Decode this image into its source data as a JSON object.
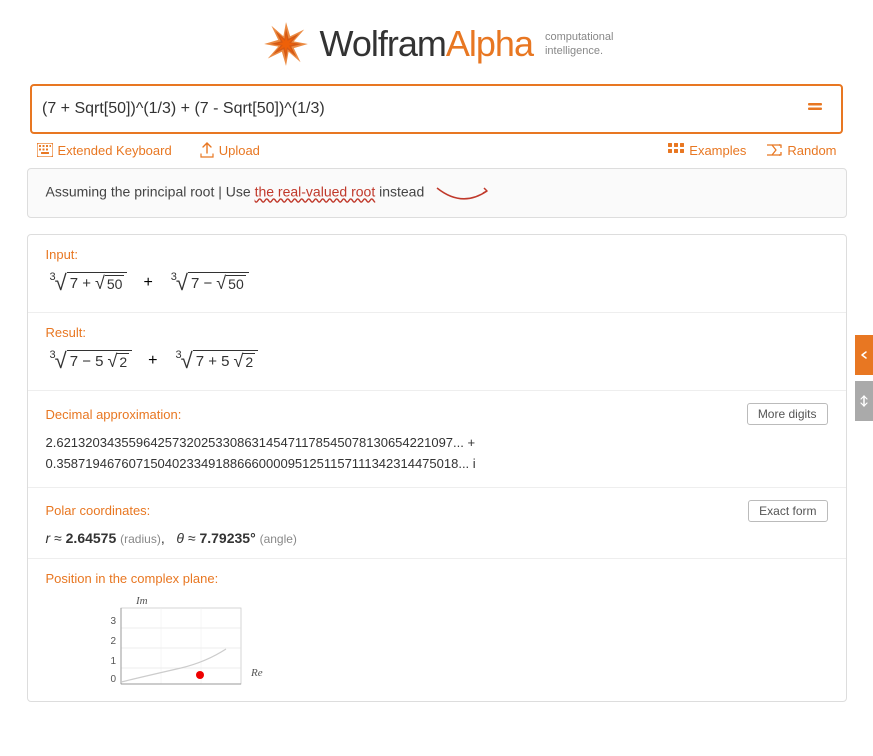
{
  "header": {
    "logo_main": "Wolfram",
    "logo_accent": "Alpha",
    "tagline_line1": "computational",
    "tagline_line2": "intelligence."
  },
  "search": {
    "query": "(7 + Sqrt[50])^(1/3) + (7 - Sqrt[50])^(1/3)",
    "icon": "≡"
  },
  "toolbar": {
    "keyboard_label": "Extended Keyboard",
    "upload_label": "Upload",
    "examples_label": "Examples",
    "random_label": "Random"
  },
  "assumption": {
    "text_before": "Assuming the principal root | Use ",
    "link_text": "the real-valued root",
    "text_after": " instead"
  },
  "input_section": {
    "label": "Input:"
  },
  "result_section": {
    "label": "Result:"
  },
  "decimal_section": {
    "label": "Decimal approximation:",
    "button": "More digits",
    "value_line1": "2.6213203435596425732025330863145471178545078130654221097... +",
    "value_line2": "0.35871946760715040233491886660000951251157111342314475018... i"
  },
  "polar_section": {
    "label": "Polar coordinates:",
    "button": "Exact form",
    "value": "r ≈ 2.64575  (radius),   θ ≈ 7.79235°  (angle)"
  },
  "complex_section": {
    "label": "Position in the complex plane:"
  }
}
